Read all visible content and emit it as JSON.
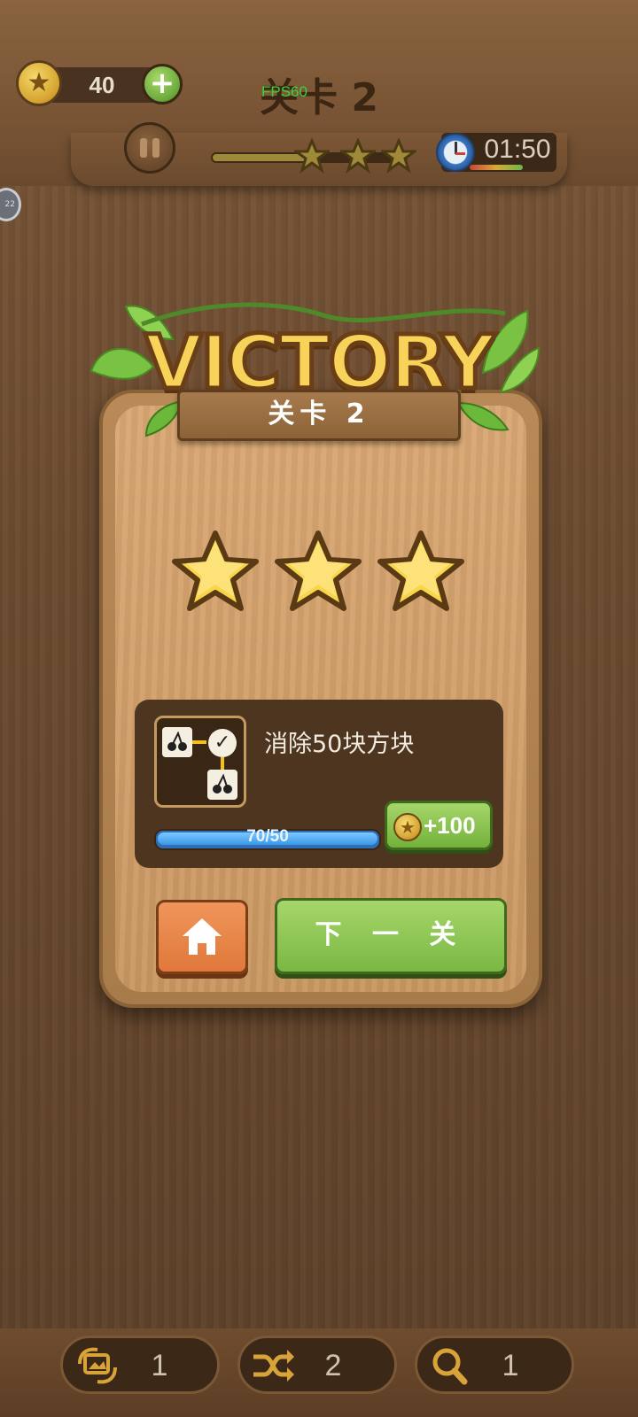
{
  "hud": {
    "coins": "40",
    "level_title": "关卡 2",
    "fps": "FPS60",
    "timer": "01:50",
    "level_progress": 0.55
  },
  "victory": {
    "title": "VICTORY",
    "level_label": "关卡 2",
    "stars_earned": 3,
    "stars_total": 3
  },
  "quest": {
    "description": "消除50块方块",
    "progress_text": "70/50",
    "progress": 1.0,
    "reward": "+100"
  },
  "buttons": {
    "next_label": "下 一 关"
  },
  "tools": [
    {
      "name": "swap-image-icon",
      "count": "1"
    },
    {
      "name": "shuffle-icon",
      "count": "2"
    },
    {
      "name": "search-icon",
      "count": "1"
    }
  ],
  "colors": {
    "wood": "#7a5738",
    "gold": "#f7d35a",
    "green_button": "#7ab842",
    "orange_button": "#e0783a",
    "progress_blue": "#3a98e8"
  }
}
